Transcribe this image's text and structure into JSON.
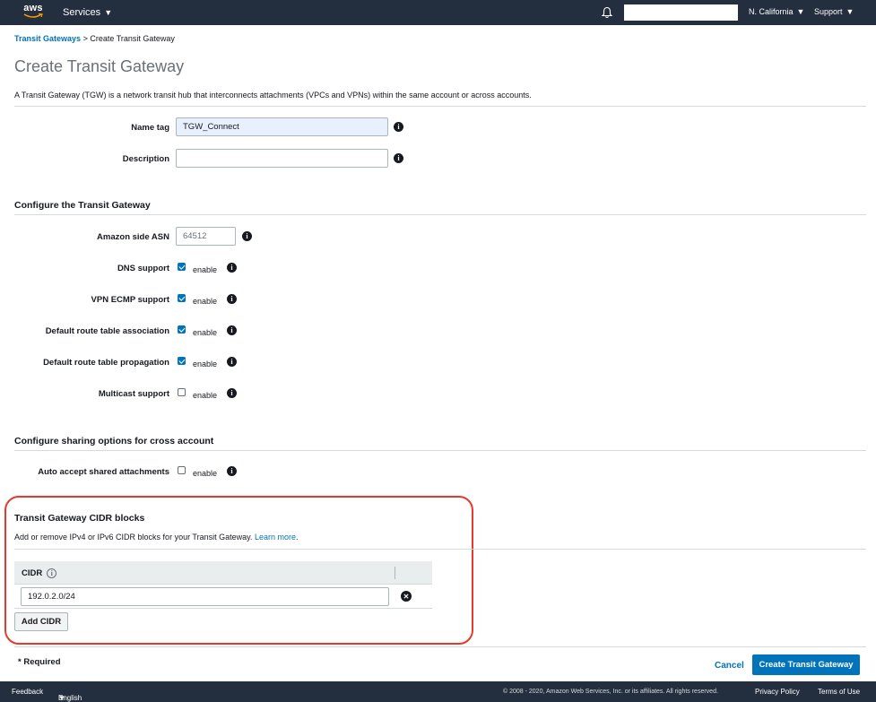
{
  "topnav": {
    "logo_text": "aws",
    "services_label": "Services",
    "region_label": "N. California",
    "support_label": "Support"
  },
  "breadcrumb": {
    "parent": "Transit Gateways",
    "separator": ">",
    "current": "Create Transit Gateway"
  },
  "page": {
    "title": "Create Transit Gateway",
    "intro": "A Transit Gateway (TGW) is a network transit hub that interconnects attachments (VPCs and VPNs) within the same account or across accounts."
  },
  "basic": {
    "name_tag_label": "Name tag",
    "name_tag_value": "TGW_Connect",
    "description_label": "Description",
    "description_value": ""
  },
  "configure": {
    "title": "Configure the Transit Gateway",
    "asn_label": "Amazon side ASN",
    "asn_value": "64512",
    "enable_text": "enable",
    "options": [
      {
        "label": "DNS support",
        "checked": true
      },
      {
        "label": "VPN ECMP support",
        "checked": true
      },
      {
        "label": "Default route table association",
        "checked": true
      },
      {
        "label": "Default route table propagation",
        "checked": true
      },
      {
        "label": "Multicast support",
        "checked": false
      }
    ]
  },
  "sharing": {
    "title": "Configure sharing options for cross account",
    "auto_accept_label": "Auto accept shared attachments",
    "auto_accept_checked": false
  },
  "cidr": {
    "title": "Transit Gateway CIDR blocks",
    "description": "Add or remove IPv4 or IPv6 CIDR blocks for your Transit Gateway.",
    "learn_more": "Learn more",
    "learn_more_suffix": ".",
    "column_header": "CIDR",
    "rows": [
      "192.0.2.0/24"
    ],
    "add_button": "Add CIDR",
    "highlight_color": "#e8392a"
  },
  "actions": {
    "required_note": "* Required",
    "cancel": "Cancel",
    "submit": "Create Transit Gateway"
  },
  "footer": {
    "feedback": "Feedback",
    "language": "English (US)",
    "copyright": "© 2008 - 2020, Amazon Web Services, Inc. or its affiliates. All rights reserved.",
    "privacy": "Privacy Policy",
    "terms": "Terms of Use"
  }
}
